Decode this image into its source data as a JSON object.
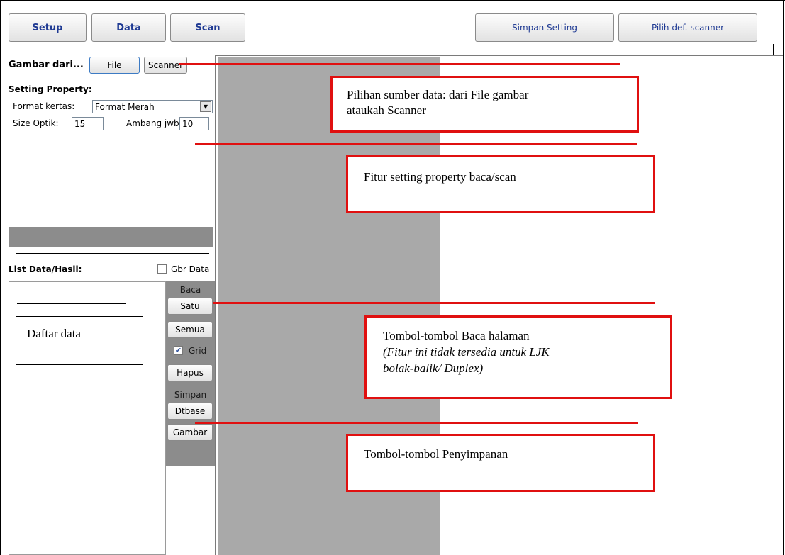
{
  "toolbar": {
    "setup": "Setup",
    "data": "Data",
    "scan": "Scan",
    "save_setting": "Simpan Setting",
    "choose_scanner": "Pilih def. scanner"
  },
  "source": {
    "label": "Gambar dari...",
    "file": "File",
    "scanner": "Scanner"
  },
  "setting": {
    "title": "Setting Property:",
    "format_label": "Format kertas:",
    "format_value": "Format Merah",
    "size_label": "Size Optik:",
    "size_value": "15",
    "threshold_label": "Ambang jwb:",
    "threshold_value": "10"
  },
  "list": {
    "title": "List Data/Hasil:",
    "gbr_label": "Gbr Data",
    "gbr_checked": false
  },
  "side": {
    "baca": "Baca",
    "satu": "Satu",
    "semua": "Semua",
    "grid_label": "Grid",
    "grid_checked": true,
    "hapus": "Hapus",
    "simpan": "Simpan",
    "dtbase": "Dtbase",
    "gambar": "Gambar"
  },
  "callouts": {
    "source_line1": "Pilihan sumber data: dari File gambar",
    "source_line2": "ataukah Scanner",
    "setting": "Fitur setting property baca/scan",
    "daftar": "Daftar data",
    "read_line1": "Tombol-tombol Baca halaman",
    "read_line2": "(Fitur ini tidak tersedia untuk LJK",
    "read_line3": "bolak-balik/ Duplex)",
    "save": "Tombol-tombol Penyimpanan"
  },
  "colors": {
    "callout_border": "#e01010",
    "panel_gray": "#8c8c8c",
    "preview_gray": "#a9a9a9",
    "tab_text": "#1f3a93"
  }
}
